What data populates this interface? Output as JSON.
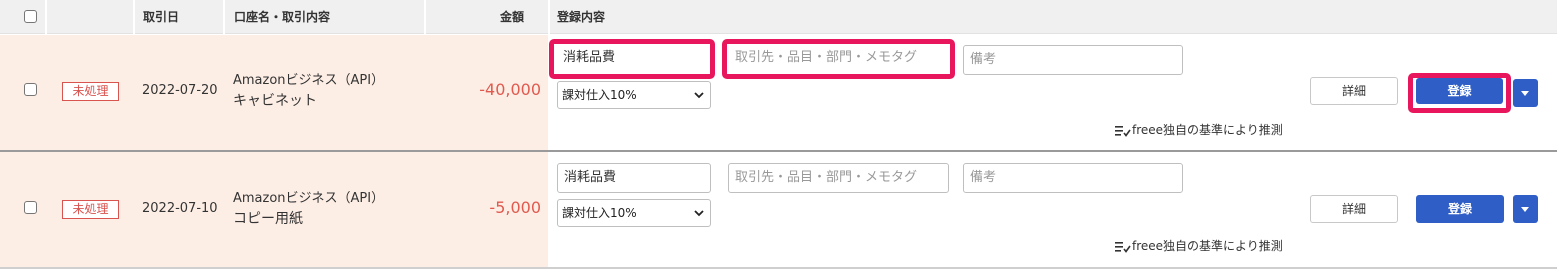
{
  "header": {
    "date": "取引日",
    "account": "口座名・取引内容",
    "amount": "金額",
    "register": "登録内容"
  },
  "rows": [
    {
      "status": "未処理",
      "date": "2022-07-20",
      "account": "Amazonビジネス（API）",
      "description": "キャビネット",
      "amount": "-40,000",
      "category": "消耗品費",
      "partner_placeholder": "取引先・品目・部門・メモタグ",
      "note_placeholder": "備考",
      "tax": "課対仕入10%",
      "detail_button": "詳細",
      "register_button": "登録",
      "guess_text": "freee独自の基準により推測"
    },
    {
      "status": "未処理",
      "date": "2022-07-10",
      "account": "Amazonビジネス（API）",
      "description": "コピー用紙",
      "amount": "-5,000",
      "category": "消耗品費",
      "partner_placeholder": "取引先・品目・部門・メモタグ",
      "note_placeholder": "備考",
      "tax": "課対仕入10%",
      "detail_button": "詳細",
      "register_button": "登録",
      "guess_text": "freee独自の基準により推測"
    }
  ],
  "colors": {
    "highlight": "#e8175d",
    "primary_button": "#2f5ec6",
    "amount_negative": "#e05a4f",
    "unprocessed_badge": "#d9534f",
    "row_bg": "#fdeee5"
  },
  "icons": [
    "checkbox",
    "chevron-down-icon",
    "caret-down-icon",
    "guess-list-icon"
  ]
}
